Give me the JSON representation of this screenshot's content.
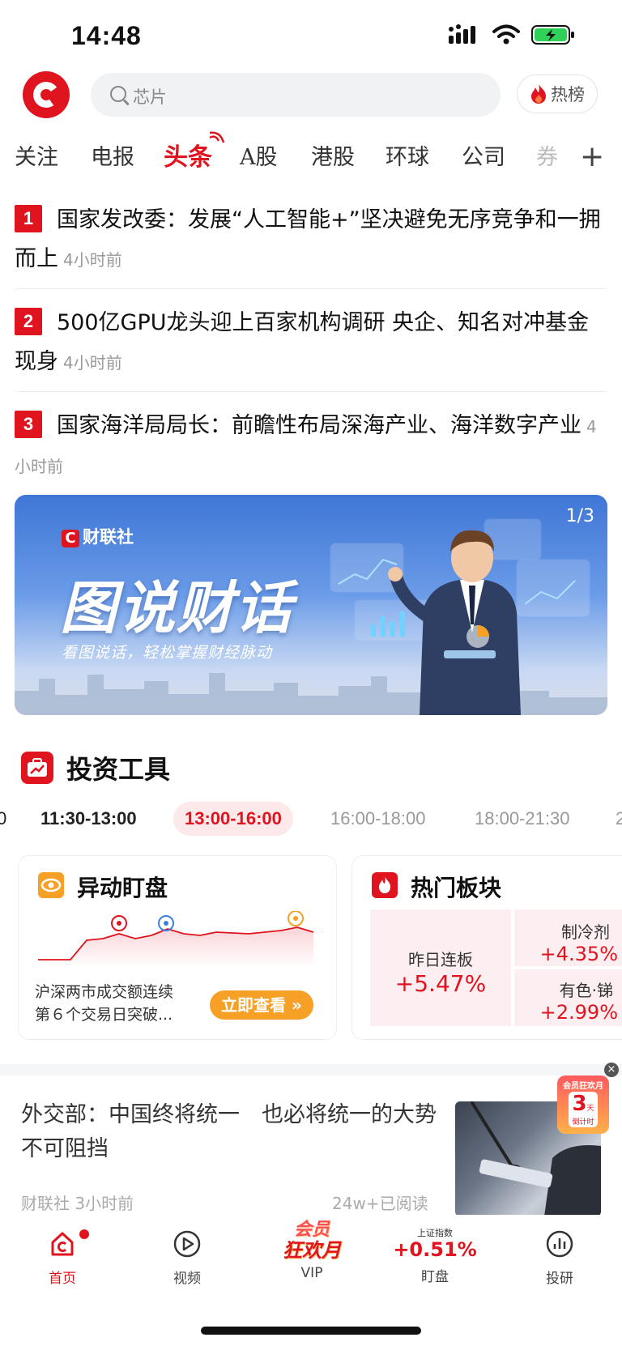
{
  "status_bar": {
    "time": "14:48"
  },
  "header": {
    "search_placeholder": "芯片",
    "hot_label": "热榜"
  },
  "tabs": [
    "关注",
    "电报",
    "头条",
    "A股",
    "港股",
    "环球",
    "公司",
    "券"
  ],
  "news": [
    {
      "rank": "1",
      "title": "国家发改委：发展“人工智能+”坚决避免无序竞争和一拥而上",
      "time": "4小时前"
    },
    {
      "rank": "2",
      "title": "500亿GPU龙头迎上百家机构调研 央企、知名对冲基金现身",
      "time": "4小时前"
    },
    {
      "rank": "3",
      "title": "国家海洋局局长：前瞻性布局深海产业、海洋数字产业",
      "time": "4小时前"
    }
  ],
  "banner": {
    "brand": "财联社",
    "title": "图说财话",
    "subtitle": "看图说话，轻松掌握财经脉动",
    "page": "1/3"
  },
  "tools": {
    "title": "投资工具",
    "time_tabs": [
      "0",
      "11:30-13:00",
      "13:00-16:00",
      "16:00-18:00",
      "18:00-21:30",
      "2"
    ],
    "monitor": {
      "title": "异动盯盘",
      "text1": "沪深两市成交额连续",
      "text2": "第６个交易日突破...",
      "button": "立即查看 »"
    },
    "hot_sectors": {
      "title": "热门板块",
      "main": {
        "name": "昨日连板",
        "value": "+5.47%"
      },
      "items": [
        {
          "name": "制冷剂",
          "value": "+4.35%"
        },
        {
          "name": "有色·锑",
          "value": "+2.99%"
        }
      ]
    }
  },
  "article": {
    "title": "外交部：中国终将统一　也必将统一的大势不可阻挡",
    "source": "财联社 3小时前",
    "reads": "24w+已阅读"
  },
  "promo": {
    "top": "会员狂欢月",
    "num": "3",
    "unit": "天",
    "bottom": "倒计时"
  },
  "bottom_nav": {
    "home": "首页",
    "video": "视频",
    "vip": "VIP",
    "vip_badge_line1": "会员",
    "vip_badge_line2": "狂欢月",
    "index_name": "上证指数",
    "index_value": "+0.51%",
    "watch": "盯盘",
    "research": "投研"
  },
  "colors": {
    "brand_red": "#e0141e",
    "orange": "#f6a025",
    "tab_active_bg": "#fde8ea"
  }
}
